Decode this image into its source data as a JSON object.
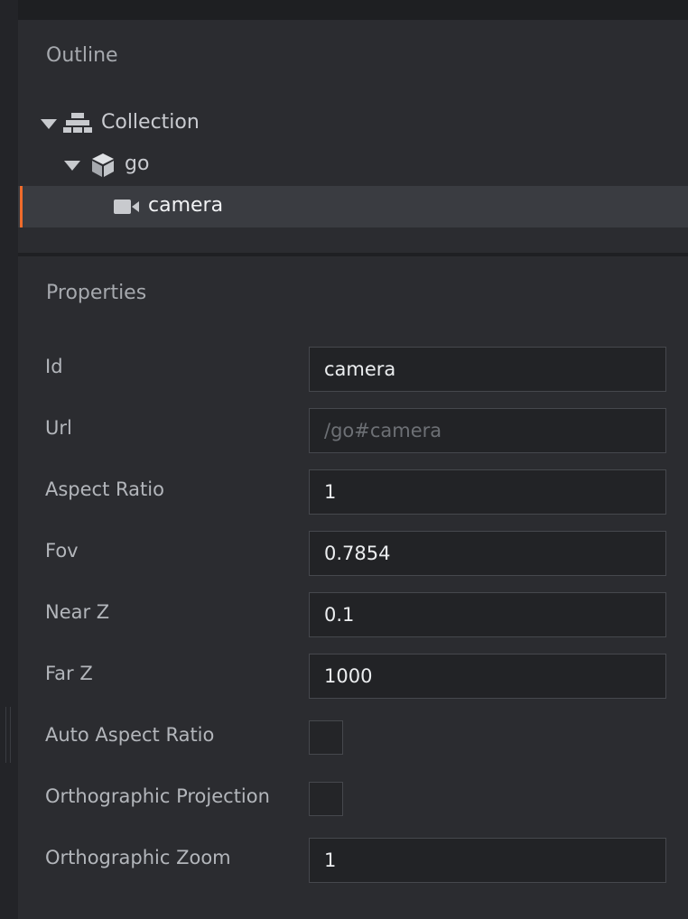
{
  "outline": {
    "title": "Outline",
    "items": [
      {
        "label": "Collection",
        "icon": "collection-icon",
        "expanded": true
      },
      {
        "label": "go",
        "icon": "game-object-icon",
        "expanded": true
      },
      {
        "label": "camera",
        "icon": "camera-icon",
        "selected": true
      }
    ]
  },
  "properties": {
    "title": "Properties",
    "fields": [
      {
        "label": "Id",
        "value": "camera"
      },
      {
        "label": "Url",
        "value": "/go#camera"
      },
      {
        "label": "Aspect Ratio",
        "value": "1"
      },
      {
        "label": "Fov",
        "value": "0.7854"
      },
      {
        "label": "Near Z",
        "value": "0.1"
      },
      {
        "label": "Far Z",
        "value": "1000"
      },
      {
        "label": "Auto Aspect Ratio",
        "checked": false
      },
      {
        "label": "Orthographic Projection",
        "checked": false
      },
      {
        "label": "Orthographic Zoom",
        "value": "1"
      }
    ]
  },
  "colors": {
    "selection_accent": "#f06b2b",
    "panel_bg": "#2b2c30"
  }
}
